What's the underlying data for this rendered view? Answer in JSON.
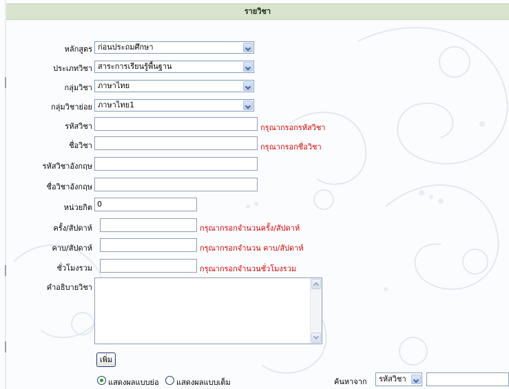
{
  "header": {
    "title": "รายวิชา"
  },
  "form": {
    "curriculum": {
      "label": "หลักสูตร",
      "value": "ก่อนประถมศึกษา"
    },
    "subject_type": {
      "label": "ประเภทวิชา",
      "value": "สาระการเรียนรู้พื้นฐาน"
    },
    "subject_group": {
      "label": "กลุ่มวิชา",
      "value": "ภาษาไทย"
    },
    "subject_subgroup": {
      "label": "กลุ่มวิชาย่อย",
      "value": "ภาษาไทย1"
    },
    "subject_code": {
      "label": "รหัสวิชา",
      "value": "",
      "hint": "กรุณากรอกรหัสวิชา"
    },
    "subject_name": {
      "label": "ชื่อวิชา",
      "value": "",
      "hint": "กรุณากรอกชื่อวิชา"
    },
    "subject_code_en": {
      "label": "รหัสวิชาอังกฤษ",
      "value": ""
    },
    "subject_name_en": {
      "label": "ชื่อวิชาอังกฤษ",
      "value": ""
    },
    "credits": {
      "label": "หน่วยกิต",
      "value": "0"
    },
    "times_per_week": {
      "label": "ครั้ง/สัปดาห์",
      "value": "",
      "hint": "กรุณากรอกจำนวนครั้ง/สัปดาห์"
    },
    "periods_per_week": {
      "label": "คาบ/สัปดาห์",
      "value": "",
      "hint": "กรุณากรอกจำนวน คาบ/สัปดาห์"
    },
    "hours": {
      "label": "ชั่วโมงรวม",
      "value": "",
      "hint": "กรุณากรอกจำนวนชั่วโมงรวม"
    },
    "description": {
      "label": "คำอธิบายวิชา",
      "value": ""
    },
    "add_button": "เพิ่ม"
  },
  "display": {
    "option_brief": "แสดงผลแบบย่อ",
    "option_full": "แสดงผลแบบเต็ม",
    "selected": "brief"
  },
  "search": {
    "label": "ค้นหาจาก",
    "field": "รหัสวิชา",
    "value": ""
  },
  "colors": {
    "header_bg": "#d8e4ce",
    "hint": "#e00000",
    "radio_dot": "#21a121"
  }
}
